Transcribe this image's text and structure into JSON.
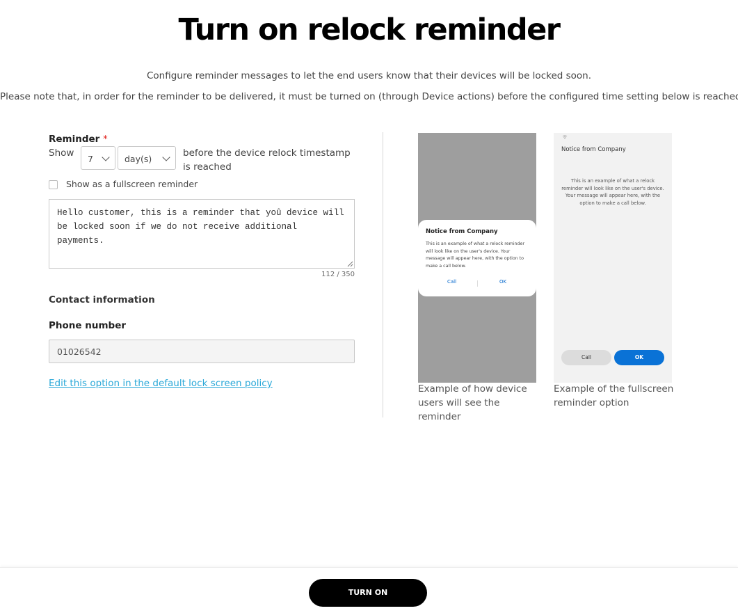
{
  "header": {
    "title": "Turn on relock reminder",
    "subtitle_1": "Configure reminder messages to let the end users know that their devices will be locked soon.",
    "subtitle_2": "Please note that, in order for the reminder to be delivered, it must be turned on (through Device actions) before the configured time setting below is reached."
  },
  "form": {
    "reminder_label": "Reminder",
    "required_mark": "*",
    "show_label": "Show",
    "amount_value": "7",
    "unit_value": "day(s)",
    "after_text": "before the device relock timestamp is reached",
    "fullscreen_label": "Show as a fullscreen reminder",
    "fullscreen_checked": false,
    "message_value": "Hello customer, this is a reminder that yoû device will be locked soon if we do not receive additional payments.",
    "char_counter": "112 / 350",
    "contact_heading": "Contact information",
    "phone_label": "Phone number",
    "phone_value": "01026542",
    "edit_link": "Edit this option in the default lock screen policy"
  },
  "preview_popup": {
    "title": "Notice from Company",
    "body": "This is an example of what a relock reminder will look like on the user's device. Your message will appear here, with the option to make a call below.",
    "call_label": "Call",
    "ok_label": "OK",
    "caption": "Example of how device users will see the reminder"
  },
  "preview_fullscreen": {
    "title": "Notice from Company",
    "body": "This is an example of what a relock reminder will look like on the user's device. Your message will appear here, with the option to make a call below.",
    "call_label": "Call",
    "ok_label": "OK",
    "caption": "Example of the fullscreen reminder option"
  },
  "footer": {
    "turn_on_label": "TURN ON"
  },
  "colors": {
    "required": "#e0201b",
    "link": "#2aa8d8",
    "ok_button": "#0a72d6",
    "primary_button": "#000000"
  },
  "icons": {
    "select_chevron": "chevron-down-icon",
    "wifi_status": "wifi-icon"
  }
}
